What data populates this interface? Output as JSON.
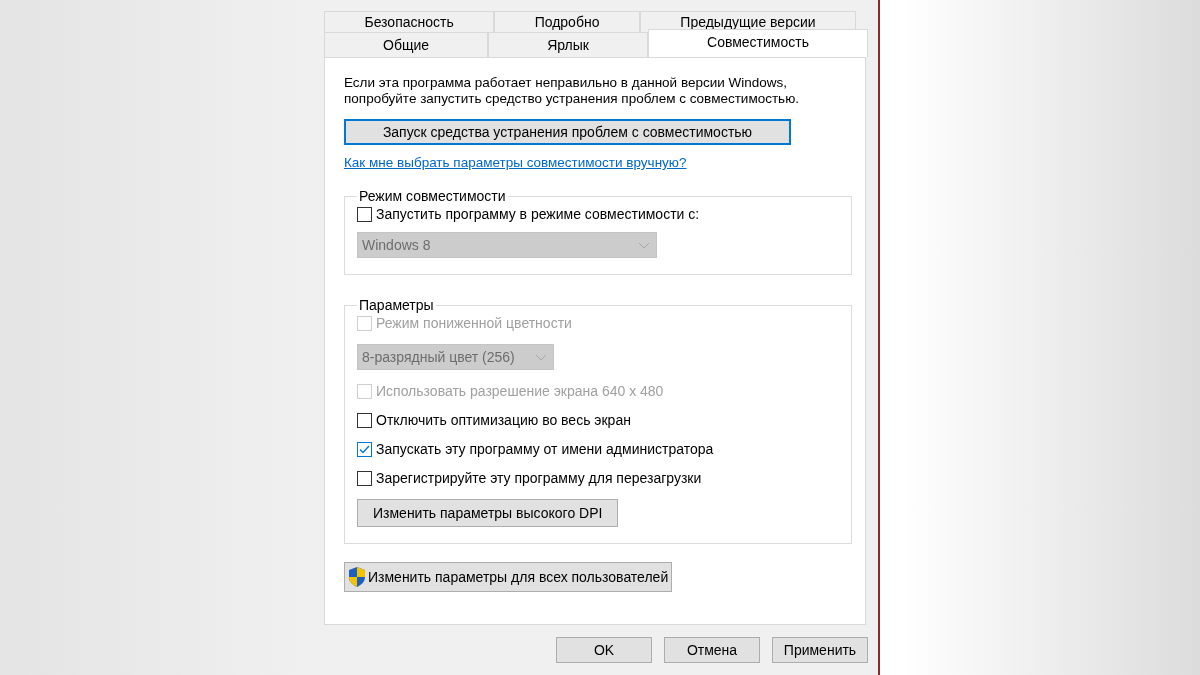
{
  "tab_rows": [
    {
      "tabs": [
        {
          "label": "Безопасность",
          "selected": false
        },
        {
          "label": "Подробно",
          "selected": false
        },
        {
          "label": "Предыдущие версии",
          "selected": false
        }
      ]
    },
    {
      "tabs": [
        {
          "label": "Общие",
          "selected": false
        },
        {
          "label": "Ярлык",
          "selected": false
        },
        {
          "label": "Совместимость",
          "selected": true
        }
      ]
    }
  ],
  "description": "Если эта программа работает неправильно в данной версии Windows, попробуйте запустить средство устранения проблем с совместимостью.",
  "troubleshoot_button": "Запуск средства устранения проблем с совместимостью",
  "help_link": "Как мне выбрать параметры совместимости вручную?",
  "groups": [
    {
      "title": "Режим совместимости",
      "items": [
        {
          "kind": "checkbox",
          "label": "Запустить программу в режиме совместимости с:",
          "checked": false,
          "disabled": false
        },
        {
          "kind": "dropdown",
          "value": "Windows 8",
          "disabled": true
        }
      ]
    },
    {
      "title": "Параметры",
      "items": [
        {
          "kind": "checkbox",
          "label": "Режим пониженной цветности",
          "checked": false,
          "disabled": true
        },
        {
          "kind": "dropdown",
          "value": "8-разрядный цвет (256)",
          "disabled": true
        },
        {
          "kind": "checkbox",
          "label": "Использовать разрешение экрана 640 x 480",
          "checked": false,
          "disabled": true
        },
        {
          "kind": "checkbox",
          "label": "Отключить оптимизацию во весь экран",
          "checked": false,
          "disabled": false
        },
        {
          "kind": "checkbox",
          "label": "Запускать эту программу от имени администратора",
          "checked": true,
          "disabled": false
        },
        {
          "kind": "checkbox",
          "label": "Зарегистрируйте эту программу для перезагрузки",
          "checked": false,
          "disabled": false
        },
        {
          "kind": "button",
          "label": "Изменить параметры высокого DPI"
        }
      ]
    }
  ],
  "all_users_button": "Изменить параметры для всех пользователей",
  "buttons": [
    "OK",
    "Отмена",
    "Применить"
  ]
}
